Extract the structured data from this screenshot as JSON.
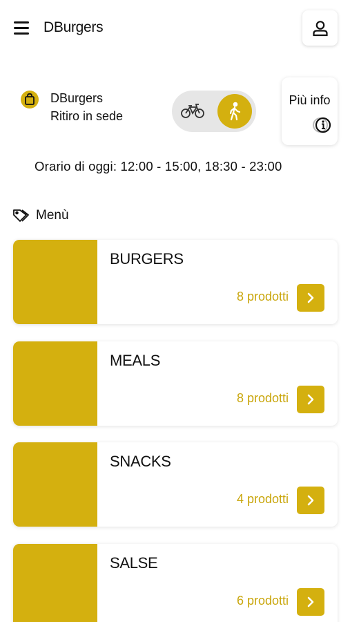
{
  "colors": {
    "accent": "#d4b00f",
    "accent_text": "#c9a60c",
    "toggle_bg": "#e6e6e6"
  },
  "header": {
    "menu_icon": "hamburger-menu-icon",
    "title": "DBurgers",
    "user_icon": "user-icon"
  },
  "store": {
    "icon": "shopping-bag-icon",
    "name": "DBurgers",
    "mode": "Ritiro in sede"
  },
  "delivery_toggle": {
    "options": [
      {
        "id": "delivery",
        "icon": "bicycle-icon",
        "selected": false
      },
      {
        "id": "pickup",
        "icon": "walking-person-icon",
        "selected": true
      }
    ]
  },
  "info_button": {
    "label": "Più info",
    "icon": "info-icon"
  },
  "hours": {
    "text": "Orario di oggi: 12:00 - 15:00, 18:30 - 23:00"
  },
  "menu": {
    "heading": "Menù",
    "heading_icon": "tag-icon",
    "categories": [
      {
        "name": "BURGERS",
        "count": "8 prodotti"
      },
      {
        "name": "MEALS",
        "count": "8 prodotti"
      },
      {
        "name": "SNACKS",
        "count": "4 prodotti"
      },
      {
        "name": "SALSE",
        "count": "6 prodotti"
      }
    ]
  }
}
